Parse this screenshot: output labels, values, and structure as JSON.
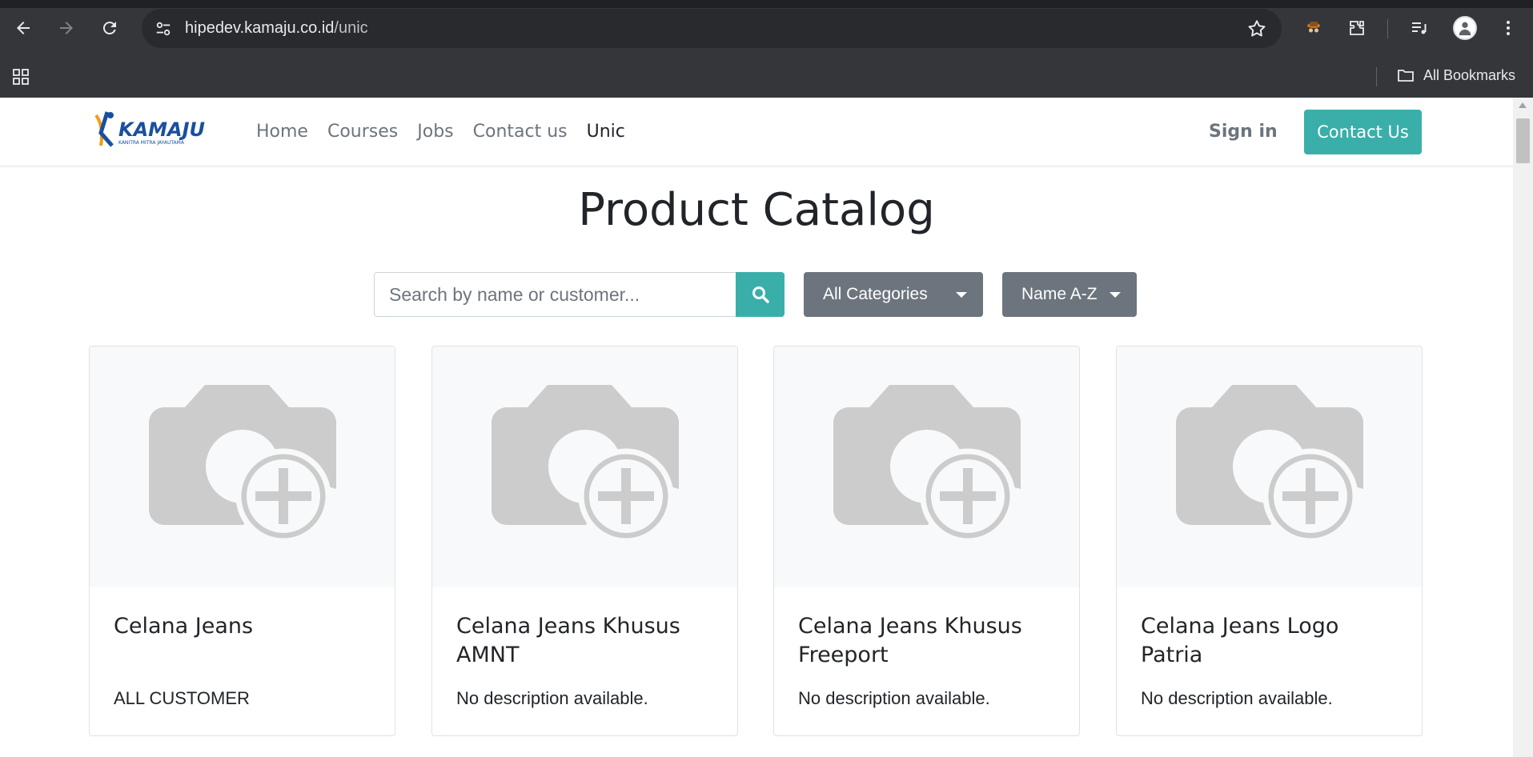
{
  "browser": {
    "url_domain": "hipedev.kamaju.co.id",
    "url_path": "/unic",
    "bookmarks_label": "All Bookmarks"
  },
  "site": {
    "logo_text": "KAMAJU",
    "logo_tagline": "KANITRA MITRA JAYAUTAMA",
    "nav": [
      {
        "label": "Home"
      },
      {
        "label": "Courses"
      },
      {
        "label": "Jobs"
      },
      {
        "label": "Contact us"
      },
      {
        "label": "Unic"
      }
    ],
    "signin_label": "Sign in",
    "contact_button_label": "Contact Us"
  },
  "main": {
    "title": "Product Catalog",
    "search_placeholder": "Search by name or customer...",
    "category_dropdown": "All Categories",
    "sort_dropdown": "Name A-Z",
    "products": [
      {
        "name": "Celana Jeans",
        "description": "ALL CUSTOMER"
      },
      {
        "name": "Celana Jeans Khusus AMNT",
        "description": "No description available."
      },
      {
        "name": "Celana Jeans Khusus Freeport",
        "description": "No description available."
      },
      {
        "name": "Celana Jeans Logo Patria",
        "description": "No description available."
      }
    ]
  },
  "colors": {
    "accent": "#3aafa9",
    "secondary": "#6c757d",
    "chrome": "#35363a"
  }
}
